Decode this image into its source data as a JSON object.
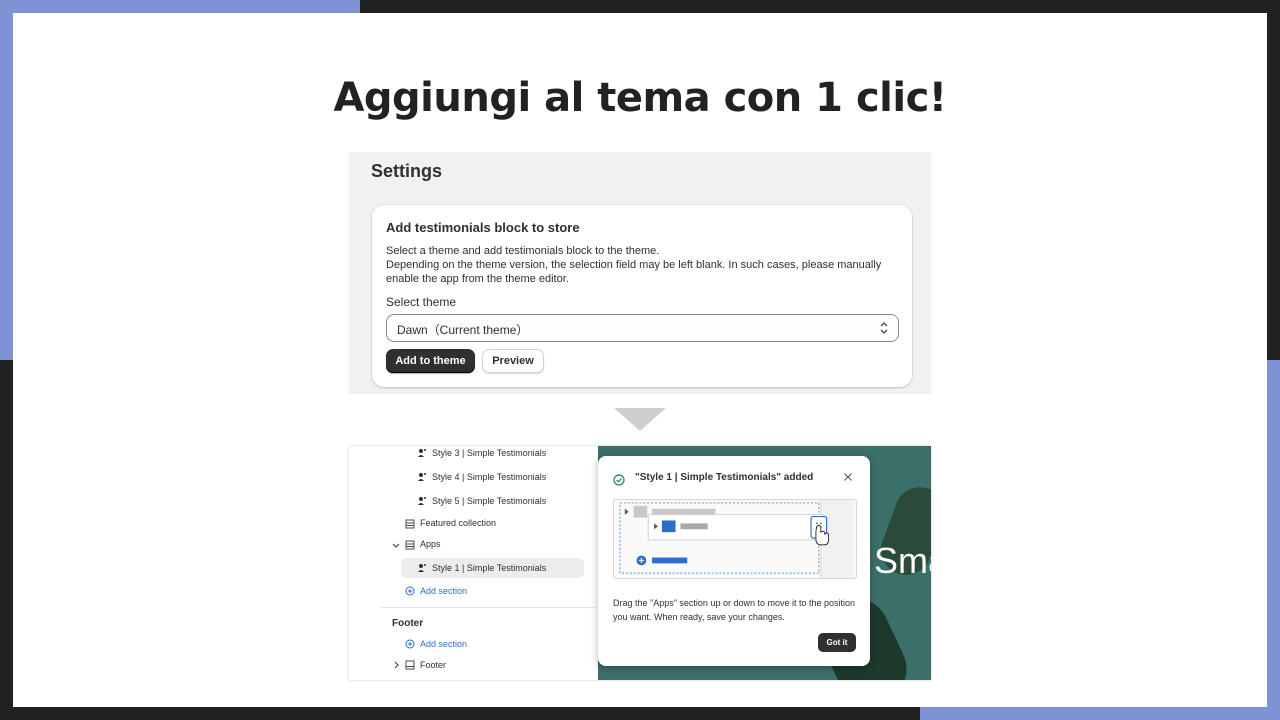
{
  "headline": "Aggiungi al tema con 1 clic!",
  "settings": {
    "title": "Settings",
    "card_title": "Add testimonials block to store",
    "description_line1": "Select a theme and add testimonials block to the theme.",
    "description_line2": "Depending on the theme version, the selection field may be left blank. In such cases, please manually enable the app from the theme editor.",
    "select_label": "Select theme",
    "select_value": "Dawn（Current theme）",
    "add_button": "Add to theme",
    "preview_button": "Preview"
  },
  "editor": {
    "tree": [
      {
        "label": "Style 3 | Simple Testimonials",
        "icon": "testimonial-icon"
      },
      {
        "label": "Style 4 | Simple Testimonials",
        "icon": "testimonial-icon"
      },
      {
        "label": "Style 5 | Simple Testimonials",
        "icon": "testimonial-icon"
      },
      {
        "label": "Featured collection",
        "icon": "section-icon"
      },
      {
        "label": "Apps",
        "icon": "section-icon"
      },
      {
        "label": "Style 1 | Simple Testimonials",
        "icon": "testimonial-icon"
      },
      {
        "label": "Add section",
        "icon": "plus-circle-icon"
      }
    ],
    "footer_group": {
      "title": "Footer",
      "add_section": "Add section",
      "footer_item": "Footer"
    },
    "preview_text": "Sma",
    "popover": {
      "title": "\"Style 1 | Simple Testimonials\" added",
      "text": "Drag the \"Apps\" section up or down to move it to the position you want. When ready, save your changes.",
      "button": "Got it"
    }
  },
  "colors": {
    "accent": "#7f92d6",
    "dark": "#303030",
    "link": "#2c6ecb",
    "preview_bg": "#3b6f6a"
  }
}
